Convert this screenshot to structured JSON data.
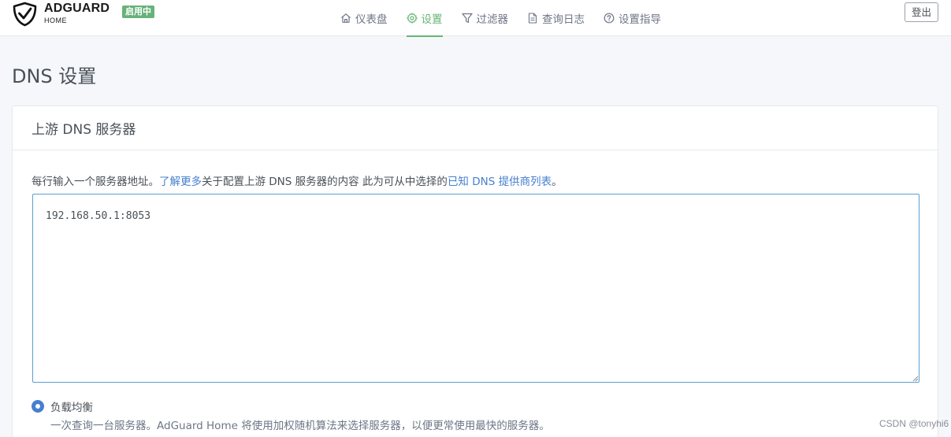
{
  "header": {
    "logo_title": "ADGUARD",
    "logo_subtitle": "HOME",
    "status_badge": "启用中",
    "nav": [
      {
        "label": "仪表盘",
        "icon": "home-icon"
      },
      {
        "label": "设置",
        "icon": "gear-icon",
        "active": true
      },
      {
        "label": "过滤器",
        "icon": "filter-icon"
      },
      {
        "label": "查询日志",
        "icon": "document-icon"
      },
      {
        "label": "设置指导",
        "icon": "help-circle-icon"
      }
    ],
    "logout_label": "登出"
  },
  "page": {
    "title": "DNS 设置"
  },
  "upstream_card": {
    "title": "上游 DNS 服务器",
    "description": {
      "part1": "每行输入一个服务器地址。",
      "link1": "了解更多",
      "part2": "关于配置上游 DNS 服务器的内容 此为可从中选择的",
      "link2": "已知 DNS 提供商列表",
      "part3": "。"
    },
    "servers_value": "192.168.50.1:8053",
    "mode_option": {
      "label": "负载均衡",
      "selected": true,
      "help": "一次查询一台服务器。AdGuard Home 将使用加权随机算法来选择服务器，以便更常使用最快的服务器。"
    }
  },
  "watermark": "CSDN @tonyhi6",
  "colors": {
    "accent_green": "#66b574",
    "badge_green": "#67b279",
    "link_blue": "#467fcf",
    "input_border": "#5aa0ce"
  }
}
